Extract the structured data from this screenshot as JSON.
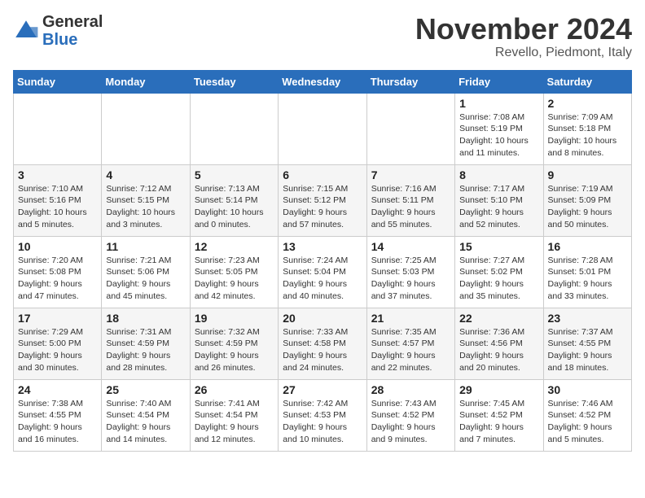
{
  "logo": {
    "general": "General",
    "blue": "Blue"
  },
  "header": {
    "month": "November 2024",
    "location": "Revello, Piedmont, Italy"
  },
  "days_of_week": [
    "Sunday",
    "Monday",
    "Tuesday",
    "Wednesday",
    "Thursday",
    "Friday",
    "Saturday"
  ],
  "weeks": [
    [
      {
        "day": "",
        "info": ""
      },
      {
        "day": "",
        "info": ""
      },
      {
        "day": "",
        "info": ""
      },
      {
        "day": "",
        "info": ""
      },
      {
        "day": "",
        "info": ""
      },
      {
        "day": "1",
        "info": "Sunrise: 7:08 AM\nSunset: 5:19 PM\nDaylight: 10 hours and 11 minutes."
      },
      {
        "day": "2",
        "info": "Sunrise: 7:09 AM\nSunset: 5:18 PM\nDaylight: 10 hours and 8 minutes."
      }
    ],
    [
      {
        "day": "3",
        "info": "Sunrise: 7:10 AM\nSunset: 5:16 PM\nDaylight: 10 hours and 5 minutes."
      },
      {
        "day": "4",
        "info": "Sunrise: 7:12 AM\nSunset: 5:15 PM\nDaylight: 10 hours and 3 minutes."
      },
      {
        "day": "5",
        "info": "Sunrise: 7:13 AM\nSunset: 5:14 PM\nDaylight: 10 hours and 0 minutes."
      },
      {
        "day": "6",
        "info": "Sunrise: 7:15 AM\nSunset: 5:12 PM\nDaylight: 9 hours and 57 minutes."
      },
      {
        "day": "7",
        "info": "Sunrise: 7:16 AM\nSunset: 5:11 PM\nDaylight: 9 hours and 55 minutes."
      },
      {
        "day": "8",
        "info": "Sunrise: 7:17 AM\nSunset: 5:10 PM\nDaylight: 9 hours and 52 minutes."
      },
      {
        "day": "9",
        "info": "Sunrise: 7:19 AM\nSunset: 5:09 PM\nDaylight: 9 hours and 50 minutes."
      }
    ],
    [
      {
        "day": "10",
        "info": "Sunrise: 7:20 AM\nSunset: 5:08 PM\nDaylight: 9 hours and 47 minutes."
      },
      {
        "day": "11",
        "info": "Sunrise: 7:21 AM\nSunset: 5:06 PM\nDaylight: 9 hours and 45 minutes."
      },
      {
        "day": "12",
        "info": "Sunrise: 7:23 AM\nSunset: 5:05 PM\nDaylight: 9 hours and 42 minutes."
      },
      {
        "day": "13",
        "info": "Sunrise: 7:24 AM\nSunset: 5:04 PM\nDaylight: 9 hours and 40 minutes."
      },
      {
        "day": "14",
        "info": "Sunrise: 7:25 AM\nSunset: 5:03 PM\nDaylight: 9 hours and 37 minutes."
      },
      {
        "day": "15",
        "info": "Sunrise: 7:27 AM\nSunset: 5:02 PM\nDaylight: 9 hours and 35 minutes."
      },
      {
        "day": "16",
        "info": "Sunrise: 7:28 AM\nSunset: 5:01 PM\nDaylight: 9 hours and 33 minutes."
      }
    ],
    [
      {
        "day": "17",
        "info": "Sunrise: 7:29 AM\nSunset: 5:00 PM\nDaylight: 9 hours and 30 minutes."
      },
      {
        "day": "18",
        "info": "Sunrise: 7:31 AM\nSunset: 4:59 PM\nDaylight: 9 hours and 28 minutes."
      },
      {
        "day": "19",
        "info": "Sunrise: 7:32 AM\nSunset: 4:59 PM\nDaylight: 9 hours and 26 minutes."
      },
      {
        "day": "20",
        "info": "Sunrise: 7:33 AM\nSunset: 4:58 PM\nDaylight: 9 hours and 24 minutes."
      },
      {
        "day": "21",
        "info": "Sunrise: 7:35 AM\nSunset: 4:57 PM\nDaylight: 9 hours and 22 minutes."
      },
      {
        "day": "22",
        "info": "Sunrise: 7:36 AM\nSunset: 4:56 PM\nDaylight: 9 hours and 20 minutes."
      },
      {
        "day": "23",
        "info": "Sunrise: 7:37 AM\nSunset: 4:55 PM\nDaylight: 9 hours and 18 minutes."
      }
    ],
    [
      {
        "day": "24",
        "info": "Sunrise: 7:38 AM\nSunset: 4:55 PM\nDaylight: 9 hours and 16 minutes."
      },
      {
        "day": "25",
        "info": "Sunrise: 7:40 AM\nSunset: 4:54 PM\nDaylight: 9 hours and 14 minutes."
      },
      {
        "day": "26",
        "info": "Sunrise: 7:41 AM\nSunset: 4:54 PM\nDaylight: 9 hours and 12 minutes."
      },
      {
        "day": "27",
        "info": "Sunrise: 7:42 AM\nSunset: 4:53 PM\nDaylight: 9 hours and 10 minutes."
      },
      {
        "day": "28",
        "info": "Sunrise: 7:43 AM\nSunset: 4:52 PM\nDaylight: 9 hours and 9 minutes."
      },
      {
        "day": "29",
        "info": "Sunrise: 7:45 AM\nSunset: 4:52 PM\nDaylight: 9 hours and 7 minutes."
      },
      {
        "day": "30",
        "info": "Sunrise: 7:46 AM\nSunset: 4:52 PM\nDaylight: 9 hours and 5 minutes."
      }
    ]
  ]
}
